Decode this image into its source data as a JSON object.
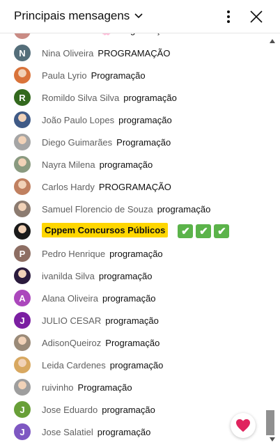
{
  "header": {
    "title": "Principais mensagens",
    "icons": {
      "dropdown": "chevron-down-icon",
      "more": "kebab-icon",
      "close": "close-icon"
    }
  },
  "messages": [
    {
      "author": "Joice Monteiro🌸",
      "text": "Programação",
      "avatar": {
        "type": "photo",
        "color": "#c98b84"
      }
    },
    {
      "author": "Nina Oliveira",
      "text": "PROGRAMAÇÃO",
      "avatar": {
        "type": "letter",
        "letter": "N",
        "color": "#546e7a"
      }
    },
    {
      "author": "Paula Lyrio",
      "text": "Programação",
      "avatar": {
        "type": "photo",
        "color": "#d9733a"
      }
    },
    {
      "author": "Romildo Silva Silva",
      "text": "programação",
      "avatar": {
        "type": "letter",
        "letter": "R",
        "color": "#33691e"
      }
    },
    {
      "author": "João Paulo Lopes",
      "text": "programação",
      "avatar": {
        "type": "photo",
        "color": "#3f5a86"
      }
    },
    {
      "author": "Diego Guimarães",
      "text": "Programação",
      "avatar": {
        "type": "photo",
        "color": "#a5a5a5"
      }
    },
    {
      "author": "Nayra Milena",
      "text": "programação",
      "avatar": {
        "type": "photo",
        "color": "#8a9a80"
      }
    },
    {
      "author": "Carlos Hardy",
      "text": "PROGRAMAÇÃO",
      "avatar": {
        "type": "photo",
        "color": "#c08060"
      }
    },
    {
      "author": "Samuel Florencio de Souza",
      "text": "programação",
      "avatar": {
        "type": "photo",
        "color": "#8c7b70"
      }
    },
    {
      "author": "Cppem Concursos Públicos",
      "text": "",
      "badge": true,
      "checks": [
        "✔",
        "✔",
        "✔"
      ],
      "avatar": {
        "type": "photo",
        "color": "#1a1a1a"
      }
    },
    {
      "author": "Pedro Henrique",
      "text": "programação",
      "avatar": {
        "type": "letter",
        "letter": "P",
        "color": "#8d6e63"
      }
    },
    {
      "author": "ivanilda Silva",
      "text": "programação",
      "avatar": {
        "type": "photo",
        "color": "#2b1b3d"
      }
    },
    {
      "author": "Alana Oliveira",
      "text": "programação",
      "avatar": {
        "type": "letter",
        "letter": "A",
        "color": "#ab47bc"
      }
    },
    {
      "author": "JULIO CESAR",
      "text": "programação",
      "avatar": {
        "type": "letter",
        "letter": "J",
        "color": "#7b1fa2"
      }
    },
    {
      "author": "AdisonQueiroz",
      "text": "Programação",
      "avatar": {
        "type": "photo",
        "color": "#9a8a78"
      }
    },
    {
      "author": "Leida Cardenes",
      "text": "programação",
      "avatar": {
        "type": "photo",
        "color": "#d8a860"
      }
    },
    {
      "author": "ruivinho",
      "text": "Programação",
      "avatar": {
        "type": "photo",
        "color": "#9e9e9e"
      }
    },
    {
      "author": "Jose Eduardo",
      "text": "programação",
      "avatar": {
        "type": "letter",
        "letter": "J",
        "color": "#689f38"
      }
    },
    {
      "author": "Jose Salatiel",
      "text": "programação",
      "avatar": {
        "type": "letter",
        "letter": "J",
        "color": "#7e57c2"
      }
    }
  ],
  "reaction_button": {
    "icon": "heart-icon",
    "color": "#e0245e"
  }
}
